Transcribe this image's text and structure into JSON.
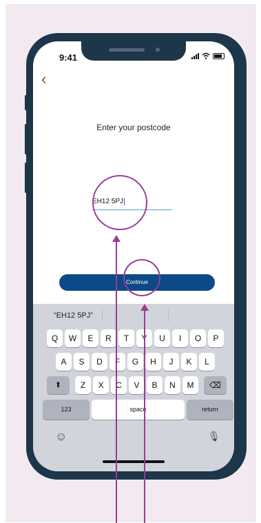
{
  "status_bar": {
    "time": "9:41"
  },
  "nav": {
    "back_glyph": "‹"
  },
  "screen": {
    "title": "Enter your postcode",
    "postcode_value": "EH12 5PJ",
    "continue_label": "Continue"
  },
  "keyboard": {
    "suggestion": "“EH12 5PJ”",
    "row1": [
      "Q",
      "W",
      "E",
      "R",
      "T",
      "Y",
      "U",
      "I",
      "O",
      "P"
    ],
    "row2": [
      "A",
      "S",
      "D",
      "F",
      "G",
      "H",
      "J",
      "K",
      "L"
    ],
    "row3": [
      "Z",
      "X",
      "C",
      "V",
      "B",
      "N",
      "M"
    ],
    "numbers_label": "123",
    "space_label": "space",
    "return_label": "return",
    "shift_glyph": "⬆",
    "delete_glyph": "⌫",
    "emoji_glyph": "☺",
    "mic_glyph": "🎙"
  },
  "annotation_color": "#9b3a96",
  "primary_color": "#0b4a87",
  "frame_color": "#1d3649"
}
